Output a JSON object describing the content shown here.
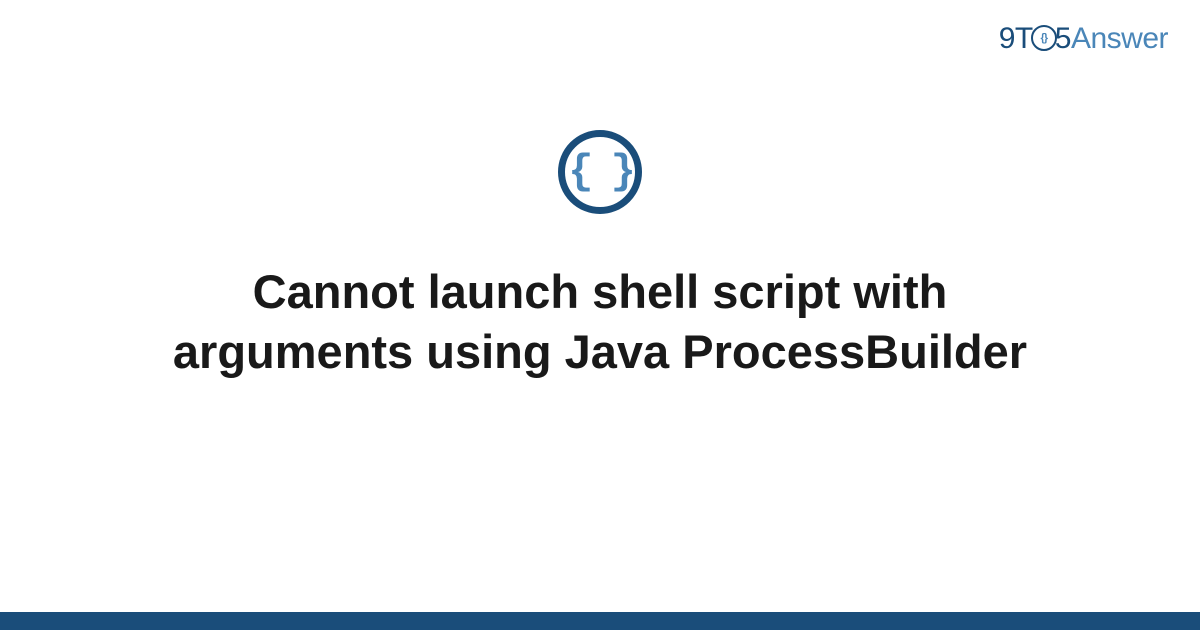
{
  "logo": {
    "part1": "9T",
    "circle_inner": "{}",
    "part2": "5",
    "part3": "Answer"
  },
  "category_icon_glyph": "{ }",
  "title": "Cannot launch shell script with arguments using Java ProcessBuilder",
  "colors": {
    "primary_dark": "#1a4d7a",
    "primary_light": "#4a86b8",
    "text": "#191919"
  }
}
